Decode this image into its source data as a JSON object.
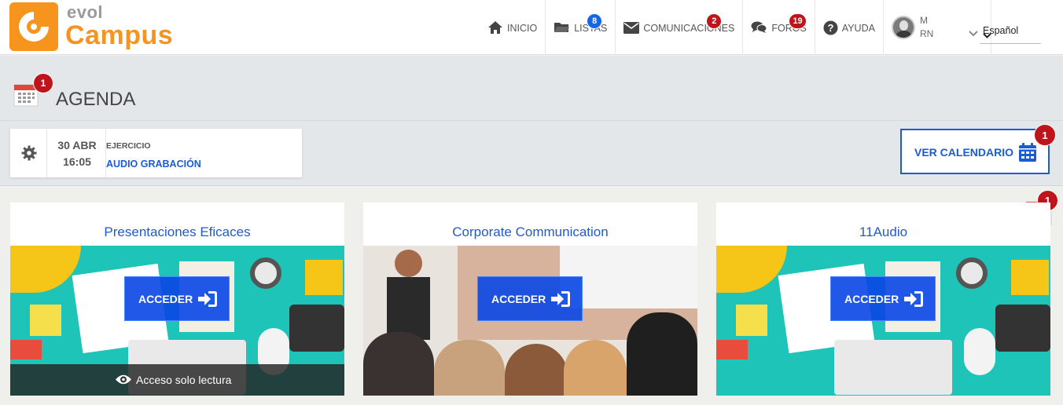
{
  "brand": {
    "line1": "evol",
    "line2": "Campus"
  },
  "nav": {
    "items": [
      {
        "label": "INICIO",
        "icon": "home-icon"
      },
      {
        "label": "LISTAS",
        "icon": "folder-icon",
        "badge": "8",
        "badge_color": "#1565e8"
      },
      {
        "label": "COMUNICACIONES",
        "icon": "envelope-icon",
        "badge": "2",
        "badge_color": "#c0141c"
      },
      {
        "label": "FOROS",
        "icon": "comments-icon",
        "badge": "19",
        "badge_color": "#c0141c"
      },
      {
        "label": "AYUDA",
        "icon": "question-circle-icon"
      }
    ],
    "user": {
      "line1": "M",
      "line2": "RN"
    },
    "language": "Español"
  },
  "agenda": {
    "title": "AGENDA",
    "badge": "1",
    "event": {
      "date": "30 ABR",
      "time": "16:05",
      "type": "EJERCICIO",
      "name": "AUDIO GRABACIÓN"
    },
    "calendar_button": {
      "label": "VER CALENDARIO",
      "badge": "1"
    },
    "side_calendar_badge": "1"
  },
  "courses": [
    {
      "title": "Presentaciones Eficaces",
      "button": "ACCEDER",
      "readonly_label": "Acceso solo lectura",
      "image": "education-illustration"
    },
    {
      "title": "Corporate Communication",
      "button": "ACCEDER",
      "image": "meeting-photo"
    },
    {
      "title": "11Audio",
      "button": "ACCEDER",
      "image": "education-illustration"
    }
  ],
  "colors": {
    "accent": "#1a5bd6",
    "badge_red": "#c0141c",
    "badge_blue": "#1565e8",
    "brand_orange": "#f7941d",
    "teal": "#1fc4b8"
  }
}
